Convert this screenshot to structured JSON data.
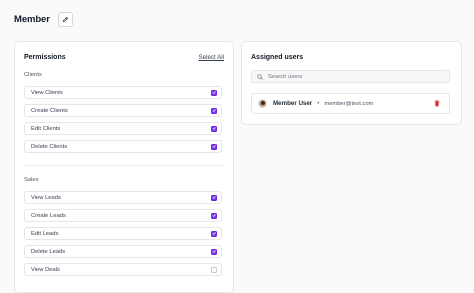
{
  "page": {
    "title": "Member"
  },
  "permissions": {
    "title": "Permissions",
    "select_all": "Select All",
    "sections": [
      {
        "label": "Clients",
        "items": [
          {
            "label": "View Clients",
            "checked": true
          },
          {
            "label": "Create Clients",
            "checked": true
          },
          {
            "label": "Edit Clients",
            "checked": true
          },
          {
            "label": "Delete Clients",
            "checked": true
          }
        ]
      },
      {
        "label": "Sales",
        "items": [
          {
            "label": "View Leads",
            "checked": true
          },
          {
            "label": "Create Leads",
            "checked": true
          },
          {
            "label": "Edit Leads",
            "checked": true
          },
          {
            "label": "Delete Leads",
            "checked": true
          },
          {
            "label": "View Deals",
            "checked": false
          }
        ]
      }
    ]
  },
  "assigned_users": {
    "title": "Assigned users",
    "search_placeholder": "Search users",
    "users": [
      {
        "name": "Member User",
        "separator": "•",
        "email": "member@test.com"
      }
    ]
  },
  "icons": {
    "edit": "pencil-icon",
    "search": "search-icon",
    "check": "check-icon",
    "delete": "trash-icon"
  },
  "colors": {
    "accent": "#7c3aed",
    "danger": "#dc2626"
  }
}
